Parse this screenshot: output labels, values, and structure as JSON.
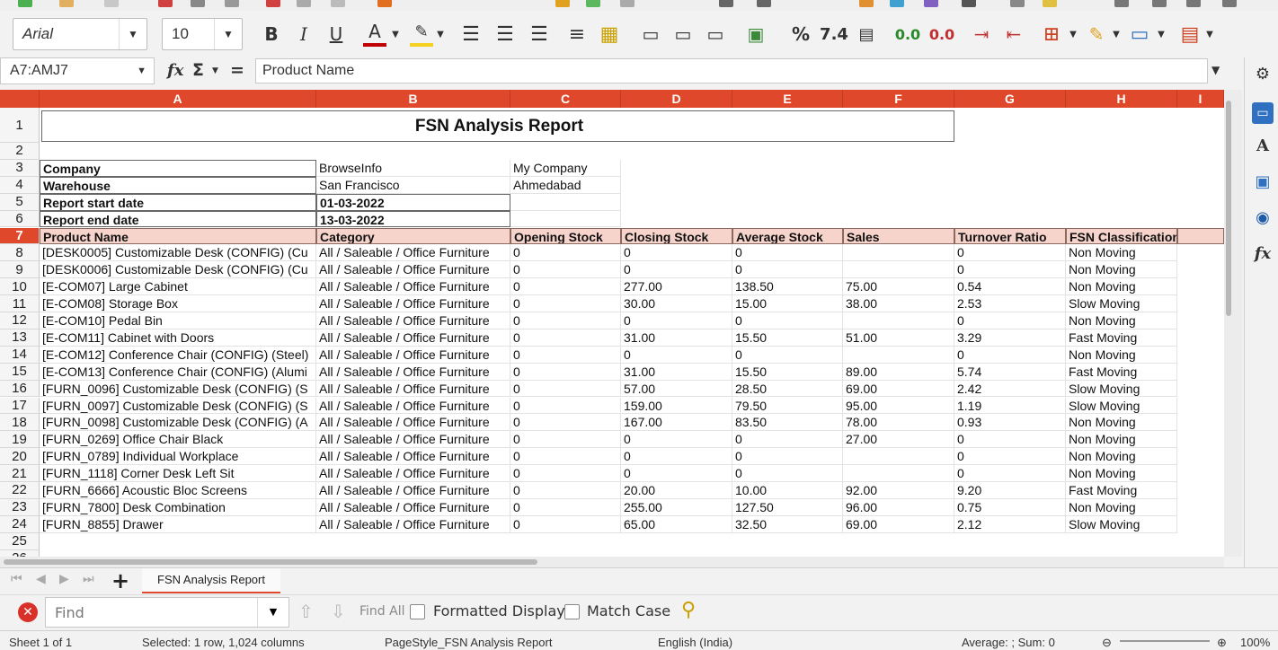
{
  "toolbar": {
    "font_name": "Arial",
    "font_size": "10",
    "bold": "B",
    "italic": "I",
    "underline": "U",
    "font_color_letter": "A",
    "percent": "%",
    "number_format": "7.4",
    "add_decimal": "0.0",
    "remove_decimal": "0.0",
    "accent_color": "#e0482c",
    "font_color": "#c00000",
    "highlight_color": "#f5d020"
  },
  "formula_bar": {
    "name_box": "A7:AMJ7",
    "fx": "fx",
    "sigma": "Σ",
    "equals": "=",
    "content": "Product Name"
  },
  "columns": [
    "A",
    "B",
    "C",
    "D",
    "E",
    "F",
    "G",
    "H",
    "I"
  ],
  "rows": [
    "1",
    "2",
    "3",
    "4",
    "5",
    "6",
    "7",
    "8",
    "9",
    "10",
    "11",
    "12",
    "13",
    "14",
    "15",
    "16",
    "17",
    "18",
    "19",
    "20",
    "21",
    "22",
    "23",
    "24",
    "25",
    "26"
  ],
  "report": {
    "title": "FSN Analysis Report",
    "info": [
      {
        "label": "Company",
        "value": "BrowseInfo",
        "extra": "My Company"
      },
      {
        "label": "Warehouse",
        "value": "San Francisco",
        "extra": "Ahmedabad"
      },
      {
        "label": "Report start date",
        "value": "01-03-2022",
        "extra": ""
      },
      {
        "label": "Report end date",
        "value": "13-03-2022",
        "extra": ""
      }
    ],
    "headers": [
      "Product Name",
      "Category",
      "Opening Stock",
      "Closing Stock",
      "Average Stock",
      "Sales",
      "Turnover Ratio",
      "FSN Classification"
    ],
    "data": [
      [
        "[DESK0005] Customizable Desk (CONFIG) (Cu",
        "All / Saleable / Office Furniture",
        "0",
        "0",
        "0",
        "",
        "0",
        "Non Moving"
      ],
      [
        "[DESK0006] Customizable Desk (CONFIG) (Cu",
        "All / Saleable / Office Furniture",
        "0",
        "0",
        "0",
        "",
        "0",
        "Non Moving"
      ],
      [
        "[E-COM07] Large Cabinet",
        "All / Saleable / Office Furniture",
        "0",
        "277.00",
        "138.50",
        "75.00",
        "0.54",
        "Non Moving"
      ],
      [
        "[E-COM08] Storage Box",
        "All / Saleable / Office Furniture",
        "0",
        "30.00",
        "15.00",
        "38.00",
        "2.53",
        "Slow Moving"
      ],
      [
        "[E-COM10] Pedal Bin",
        "All / Saleable / Office Furniture",
        "0",
        "0",
        "0",
        "",
        "0",
        "Non Moving"
      ],
      [
        "[E-COM11] Cabinet with Doors",
        "All / Saleable / Office Furniture",
        "0",
        "31.00",
        "15.50",
        "51.00",
        "3.29",
        "Fast Moving"
      ],
      [
        "[E-COM12] Conference Chair (CONFIG) (Steel)",
        "All / Saleable / Office Furniture",
        "0",
        "0",
        "0",
        "",
        "0",
        "Non Moving"
      ],
      [
        "[E-COM13] Conference Chair (CONFIG) (Alumi",
        "All / Saleable / Office Furniture",
        "0",
        "31.00",
        "15.50",
        "89.00",
        "5.74",
        "Fast Moving"
      ],
      [
        "[FURN_0096] Customizable Desk (CONFIG) (S",
        "All / Saleable / Office Furniture",
        "0",
        "57.00",
        "28.50",
        "69.00",
        "2.42",
        "Slow Moving"
      ],
      [
        "[FURN_0097] Customizable Desk (CONFIG) (S",
        "All / Saleable / Office Furniture",
        "0",
        "159.00",
        "79.50",
        "95.00",
        "1.19",
        "Slow Moving"
      ],
      [
        "[FURN_0098] Customizable Desk (CONFIG) (A",
        "All / Saleable / Office Furniture",
        "0",
        "167.00",
        "83.50",
        "78.00",
        "0.93",
        "Non Moving"
      ],
      [
        "[FURN_0269] Office Chair Black",
        "All / Saleable / Office Furniture",
        "0",
        "0",
        "0",
        "27.00",
        "0",
        "Non Moving"
      ],
      [
        "[FURN_0789] Individual Workplace",
        "All / Saleable / Office Furniture",
        "0",
        "0",
        "0",
        "",
        "0",
        "Non Moving"
      ],
      [
        "[FURN_1118] Corner Desk Left Sit",
        "All / Saleable / Office Furniture",
        "0",
        "0",
        "0",
        "",
        "0",
        "Non Moving"
      ],
      [
        "[FURN_6666] Acoustic Bloc Screens",
        "All / Saleable / Office Furniture",
        "0",
        "20.00",
        "10.00",
        "92.00",
        "9.20",
        "Fast Moving"
      ],
      [
        "[FURN_7800] Desk Combination",
        "All / Saleable / Office Furniture",
        "0",
        "255.00",
        "127.50",
        "96.00",
        "0.75",
        "Non Moving"
      ],
      [
        "[FURN_8855] Drawer",
        "All / Saleable / Office Furniture",
        "0",
        "65.00",
        "32.50",
        "69.00",
        "2.12",
        "Slow Moving"
      ]
    ]
  },
  "sheet_tabs": {
    "add": "+",
    "active_tab": "FSN Analysis Report"
  },
  "find_bar": {
    "placeholder": "Find",
    "find_all": "Find All",
    "formatted_display": "Formatted Display",
    "match_case": "Match Case"
  },
  "status": {
    "sheet": "Sheet 1 of 1",
    "selection": "Selected: 1 row, 1,024 columns",
    "page_style": "PageStyle_FSN Analysis Report",
    "language": "English (India)",
    "summary": "Average: ; Sum: 0",
    "zoom": "100%"
  }
}
